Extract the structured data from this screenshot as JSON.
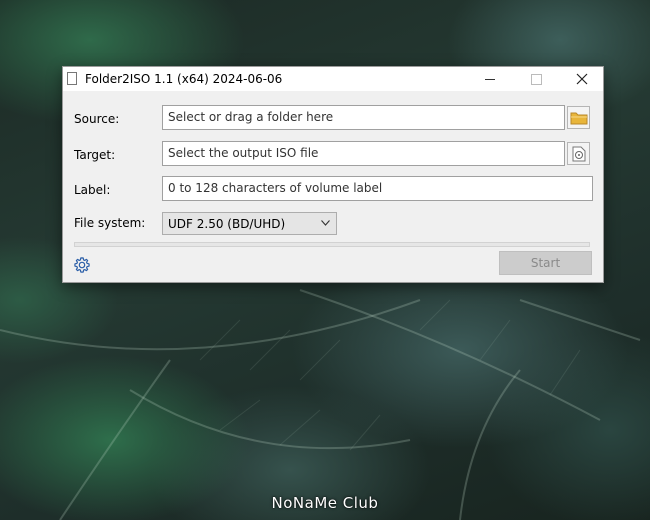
{
  "window": {
    "title": "Folder2ISO 1.1 (x64) 2024-06-06",
    "controls": {
      "minimize": "minimize",
      "maximize": "maximize",
      "close": "close"
    }
  },
  "form": {
    "source": {
      "label": "Source:",
      "placeholder": "Select or drag a folder here",
      "button_icon": "folder-icon"
    },
    "target": {
      "label": "Target:",
      "placeholder": "Select the output ISO file",
      "button_icon": "disc-file-icon"
    },
    "volume_label": {
      "label": "Label:",
      "placeholder": "0 to 128 characters of volume label"
    },
    "file_system": {
      "label": "File system:",
      "selected": "UDF 2.50 (BD/UHD)"
    }
  },
  "progress": {
    "value": 0
  },
  "footer": {
    "settings_icon": "gear-icon",
    "start_label": "Start",
    "start_enabled": false
  },
  "watermark": {
    "text": "NoNaMe Club"
  },
  "colors": {
    "accent_folder": "#e8b53a",
    "progress_fill": "#06b025",
    "disabled_button": "#cccccc"
  }
}
